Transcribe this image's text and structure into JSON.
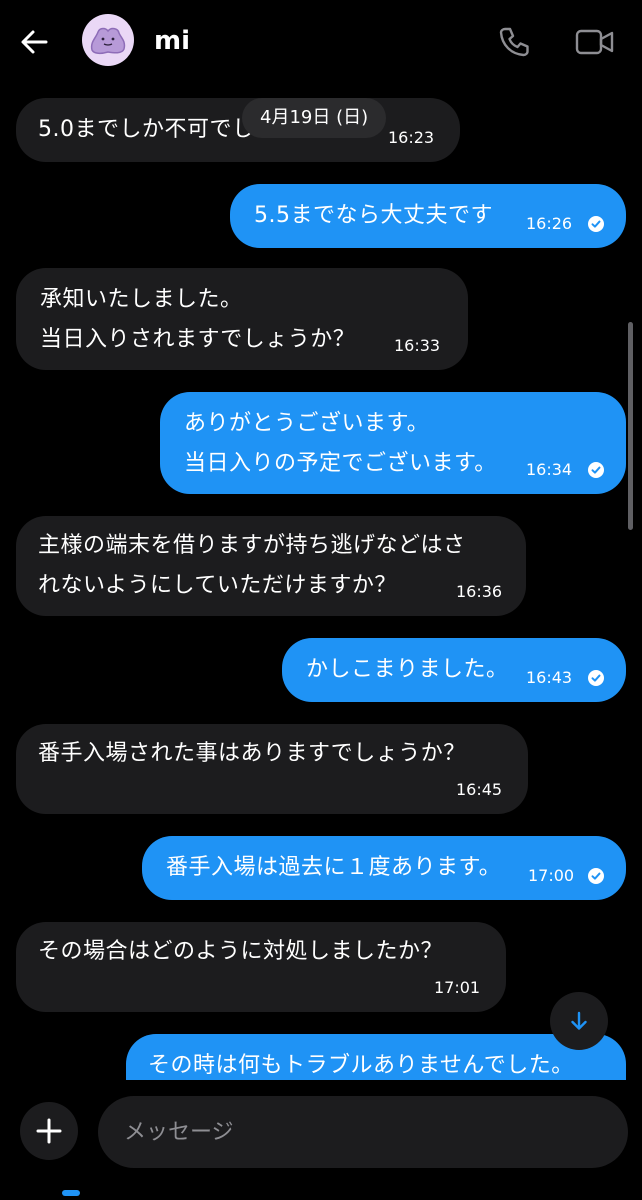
{
  "header": {
    "back_icon": "arrow-left-icon",
    "contact_name": "mi",
    "avatar_icon": "ditto-avatar-icon",
    "call_icon": "phone-icon",
    "video_icon": "video-camera-icon"
  },
  "chat": {
    "date_label": "4月19日 (日)",
    "messages": [
      {
        "direction": "in",
        "lines": [
          "5.0までしか不可でしょうか？"
        ],
        "time": "16:23"
      },
      {
        "direction": "out",
        "lines": [
          "5.5までなら大丈夫です"
        ],
        "time": "16:26"
      },
      {
        "direction": "in",
        "lines": [
          "承知いたしました。",
          "当日入りされますでしょうか？"
        ],
        "time": "16:33"
      },
      {
        "direction": "out",
        "lines": [
          "ありがとうございます。",
          "当日入りの予定でございます。"
        ],
        "time": "16:34"
      },
      {
        "direction": "in",
        "lines": [
          "主様の端末を借りますが持ち逃げなどはさ",
          "れないようにしていただけますか？"
        ],
        "time": "16:36"
      },
      {
        "direction": "out",
        "lines": [
          "かしこまりました。"
        ],
        "time": "16:43"
      },
      {
        "direction": "in",
        "lines": [
          "番手入場された事はありますでしょうか？"
        ],
        "time": "16:45"
      },
      {
        "direction": "out",
        "lines": [
          "番手入場は過去に１度あります。"
        ],
        "time": "17:00"
      },
      {
        "direction": "in",
        "lines": [
          "その場合はどのように対処しましたか？"
        ],
        "time": "17:01"
      },
      {
        "direction": "out",
        "lines": [
          "その時は何もトラブルありませんでした。"
        ],
        "time": ""
      }
    ],
    "read_icon": "check-circle-icon",
    "scroll_down_icon": "arrow-down-icon"
  },
  "composer": {
    "plus_icon": "plus-icon",
    "placeholder": "メッセージ"
  },
  "colors": {
    "background": "#000000",
    "incoming_bubble": "#1c1c1e",
    "outgoing_bubble": "#1f93f5",
    "date_pill": "#2b2b2d",
    "placeholder": "#8e8e93"
  }
}
